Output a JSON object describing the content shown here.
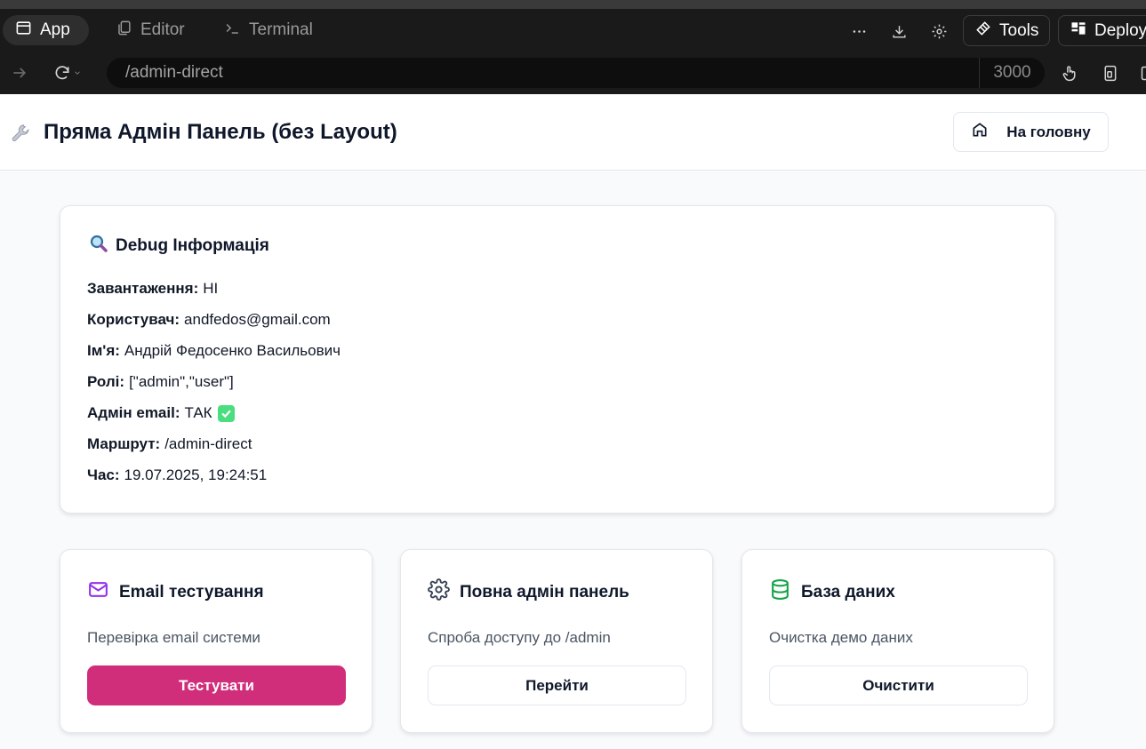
{
  "browser": {
    "tabs": [
      {
        "label": "App",
        "icon": "window-icon",
        "active": true
      },
      {
        "label": "Editor",
        "icon": "copy-icon",
        "active": false
      },
      {
        "label": "Terminal",
        "icon": "terminal-icon",
        "active": false
      }
    ],
    "tools_label": "Tools",
    "deploy_label": "Deploy",
    "url": "/admin-direct",
    "port": "3000"
  },
  "page": {
    "title": "Пряма Адмін Панель (без Layout)",
    "home_button": "На головну"
  },
  "debug": {
    "title": "Debug Інформація",
    "rows": [
      {
        "label": "Завантаження:",
        "value": "НІ"
      },
      {
        "label": "Користувач:",
        "value": "andfedos@gmail.com"
      },
      {
        "label": "Ім'я:",
        "value": "Андрій Федосенко Васильович"
      },
      {
        "label": "Ролі:",
        "value": "[\"admin\",\"user\"]"
      },
      {
        "label": "Адмін email:",
        "value": "ТАК"
      },
      {
        "label": "Маршрут:",
        "value": "/admin-direct"
      },
      {
        "label": "Час:",
        "value": "19.07.2025, 19:24:51"
      }
    ]
  },
  "cards": [
    {
      "title": "Email тестування",
      "description": "Перевірка email системи",
      "button": "Тестувати",
      "icon": "mail-icon",
      "icon_color": "#9333ea"
    },
    {
      "title": "Повна адмін панель",
      "description": "Спроба доступу до /admin",
      "button": "Перейти",
      "icon": "gear-icon",
      "icon_color": "#374151"
    },
    {
      "title": "База даних",
      "description": "Очистка демо даних",
      "button": "Очистити",
      "icon": "database-icon",
      "icon_color": "#16a34a"
    }
  ],
  "colors": {
    "primary_button": "#d02d7b",
    "chrome_bg": "#1a1a1a",
    "page_bg": "#f8fafc"
  }
}
